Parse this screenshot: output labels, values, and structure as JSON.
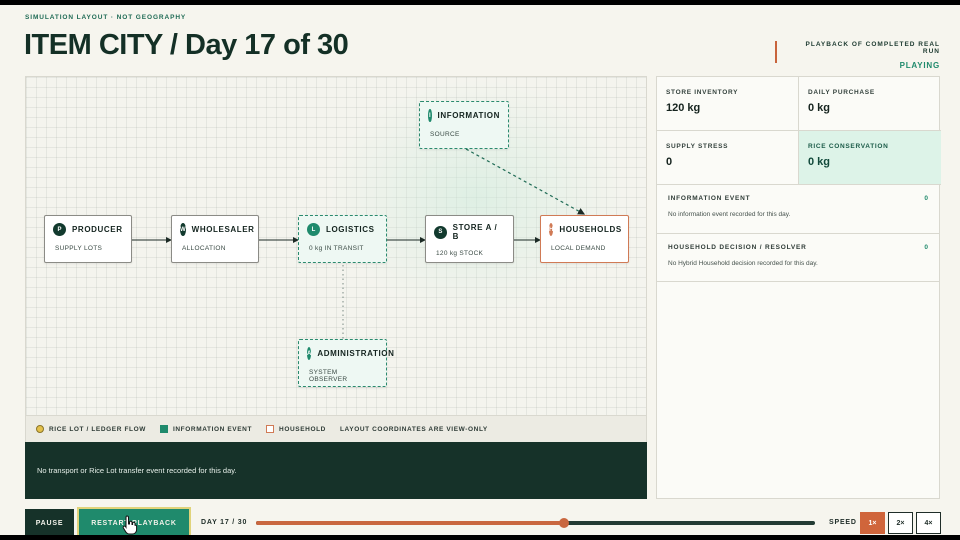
{
  "header": {
    "eyebrow": "SIMULATION LAYOUT · NOT GEOGRAPHY",
    "title": "ITEM CITY / Day 17 of 30",
    "status_label": "PLAYBACK OF COMPLETED REAL RUN",
    "status_value": "PLAYING"
  },
  "map": {
    "nodes": {
      "producer": {
        "badge": "P",
        "name": "PRODUCER",
        "sub": "SUPPLY LOTS"
      },
      "wholesaler": {
        "badge": "W",
        "name": "WHOLESALER",
        "sub": "ALLOCATION"
      },
      "logistics": {
        "badge": "L",
        "name": "LOGISTICS",
        "sub": "0 kg IN TRANSIT"
      },
      "store": {
        "badge": "S",
        "name": "STORE A / B",
        "sub": "120 kg STOCK"
      },
      "households": {
        "badge": "H",
        "name": "HOUSEHOLDS",
        "sub": "LOCAL DEMAND"
      },
      "information": {
        "badge": "I",
        "name": "INFORMATION",
        "sub": "SOURCE"
      },
      "administration": {
        "badge": "A",
        "name": "ADMINISTRATION",
        "sub": "SYSTEM OBSERVER"
      }
    }
  },
  "legend": {
    "rice_lot": "RICE LOT / LEDGER FLOW",
    "information_event": "INFORMATION EVENT",
    "household": "HOUSEHOLD",
    "note": "LAYOUT COORDINATES ARE VIEW-ONLY"
  },
  "event_log": "No transport or Rice Lot transfer event recorded for this day.",
  "side": {
    "metrics": [
      {
        "label": "STORE INVENTORY",
        "value": "120 kg"
      },
      {
        "label": "DAILY PURCHASE",
        "value": "0 kg"
      },
      {
        "label": "SUPPLY STRESS",
        "value": "0"
      },
      {
        "label": "RICE CONSERVATION",
        "value": "0 kg"
      }
    ],
    "information_event": {
      "title": "INFORMATION EVENT",
      "count": "0",
      "body": "No information event recorded for this day."
    },
    "household_decision": {
      "title": "HOUSEHOLD DECISION / RESOLVER",
      "count": "0",
      "body": "No Hybrid Household decision recorded for this day."
    }
  },
  "controls": {
    "pause_label": "PAUSE",
    "restart_label": "RESTART PLAYBACK",
    "day_label": "DAY 17 / 30",
    "day_progress": 0.5517,
    "speed_label": "SPEED",
    "speeds": [
      "1×",
      "2×",
      "4×"
    ],
    "active_speed": "1×"
  },
  "colors": {
    "accent_teal": "#1f8a6c",
    "accent_orange": "#d0653b",
    "dark_green": "#163229"
  }
}
